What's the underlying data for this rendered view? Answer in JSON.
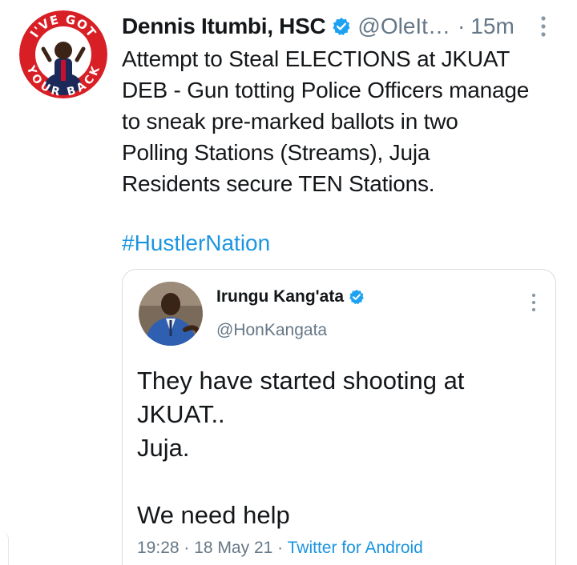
{
  "tweet": {
    "avatar_icon": "profile-avatar-badge",
    "avatar_badge_text_top": "I'VE GOT",
    "avatar_badge_text_bottom": "YOUR BACK",
    "display_name": "Dennis Itumbi, HSC",
    "handle": "@OleIt…",
    "separator": "·",
    "time": "15m",
    "text_lines": [
      "Attempt to Steal ELECTIONS at JKUAT",
      "DEB - Gun totting Police Officers manage",
      "to sneak pre-marked ballots in two",
      "Polling Stations (Streams), Juja",
      "Residents secure TEN Stations."
    ],
    "hashtag": "#HustlerNation"
  },
  "quoted": {
    "avatar_icon": "profile-avatar-photo",
    "display_name": "Irungu Kang'ata",
    "handle": "@HonKangata",
    "text_lines": [
      "They have started shooting at",
      "JKUAT..",
      "Juja.",
      "",
      "We need help"
    ],
    "time": "19:28",
    "sep1": "·",
    "date": "18 May 21",
    "sep2": "·",
    "source": "Twitter for Android"
  },
  "colors": {
    "link": "#1b95e0",
    "verified": "#1da1f2",
    "muted": "#657786",
    "badge_red": "#d81f26"
  }
}
